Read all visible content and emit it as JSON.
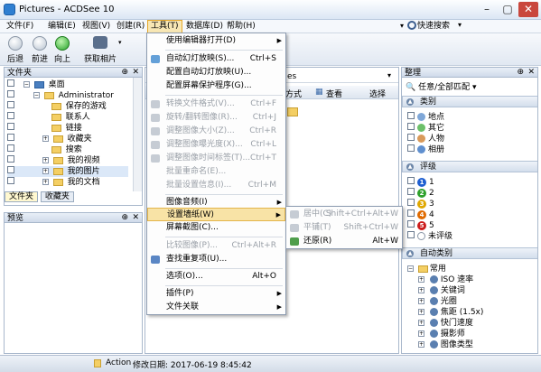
{
  "window": {
    "title": "Pictures - ACDSee 10"
  },
  "menubar": {
    "items": [
      "文件(F)",
      "编辑(E)",
      "视图(V)",
      "创建(R)",
      "工具(T)",
      "数据库(D)",
      "帮助(H)"
    ],
    "search_label": "快速搜索"
  },
  "toolbar": {
    "back": "后退",
    "forward": "前进",
    "up": "向上",
    "get_photos": "获取相片"
  },
  "folders_panel": {
    "title": "文件夹",
    "tree": [
      "桌面",
      "Administrator",
      "保存的游戏",
      "联系人",
      "链接",
      "收藏夹",
      "搜索",
      "我的视频",
      "我的图片",
      "我的文档"
    ],
    "tabs": [
      "文件夹",
      "收藏夹"
    ]
  },
  "preview_panel": {
    "title": "预览"
  },
  "browser": {
    "path_suffix": "es",
    "view_btn": "方式",
    "view2_btn": "查看",
    "select_btn": "选择"
  },
  "tools_menu": {
    "items": [
      {
        "label": "使用编辑器打开(D)",
        "shortcut": "",
        "submenu": true,
        "disabled": false
      },
      {
        "label": "自动幻灯放映(S)...",
        "shortcut": "Ctrl+S",
        "submenu": false,
        "disabled": false
      },
      {
        "label": "配置自动幻灯放映(U)...",
        "shortcut": "",
        "submenu": false,
        "disabled": false
      },
      {
        "label": "配置屏幕保护程序(G)...",
        "shortcut": "",
        "submenu": false,
        "disabled": false
      },
      {
        "label": "转换文件格式(V)...",
        "shortcut": "Ctrl+F",
        "submenu": false,
        "disabled": true
      },
      {
        "label": "旋转/翻转图像(R)...",
        "shortcut": "Ctrl+J",
        "submenu": false,
        "disabled": true
      },
      {
        "label": "调整图像大小(Z)...",
        "shortcut": "Ctrl+R",
        "submenu": false,
        "disabled": true
      },
      {
        "label": "调整图像曝光度(X)...",
        "shortcut": "Ctrl+L",
        "submenu": false,
        "disabled": true
      },
      {
        "label": "调整图像时间标签(T)...",
        "shortcut": "Ctrl+T",
        "submenu": false,
        "disabled": true
      },
      {
        "label": "批量重命名(E)...",
        "shortcut": "",
        "submenu": false,
        "disabled": true
      },
      {
        "label": "批量设置信息(I)...",
        "shortcut": "Ctrl+M",
        "submenu": false,
        "disabled": true
      },
      {
        "label": "图像音频(I)",
        "shortcut": "",
        "submenu": true,
        "disabled": false
      },
      {
        "label": "设置墙纸(W)",
        "shortcut": "",
        "submenu": true,
        "disabled": false
      },
      {
        "label": "屏幕截图(C)...",
        "shortcut": "",
        "submenu": false,
        "disabled": false
      },
      {
        "label": "比较图像(P)...",
        "shortcut": "Ctrl+Alt+R",
        "submenu": false,
        "disabled": true
      },
      {
        "label": "查找重复项(U)...",
        "shortcut": "",
        "submenu": false,
        "disabled": false
      },
      {
        "label": "选项(O)...",
        "shortcut": "Alt+O",
        "submenu": false,
        "disabled": false
      },
      {
        "label": "插件(P)",
        "shortcut": "",
        "submenu": true,
        "disabled": false
      },
      {
        "label": "文件关联",
        "shortcut": "",
        "submenu": true,
        "disabled": false
      }
    ]
  },
  "wallpaper_submenu": {
    "items": [
      {
        "label": "居中(C)",
        "shortcut": "Shift+Ctrl+Alt+W",
        "disabled": true
      },
      {
        "label": "平铺(T)",
        "shortcut": "Shift+Ctrl+W",
        "disabled": true
      },
      {
        "label": "还原(R)",
        "shortcut": "Alt+W",
        "disabled": false
      }
    ]
  },
  "organize_panel": {
    "title": "整理",
    "match_label": "任意/全部匹配",
    "sections": {
      "category": "类别",
      "rating": "评级",
      "auto": "自动类别"
    },
    "categories": [
      "地点",
      "其它",
      "人物",
      "相册"
    ],
    "ratings": [
      "1",
      "2",
      "3",
      "4",
      "5"
    ],
    "unrated": "未评级",
    "auto_items": [
      "常用",
      "ISO 速率",
      "关键词",
      "光圈",
      "焦距 (1.5x)",
      "快门速度",
      "摄影师",
      "图像类型"
    ]
  },
  "statusbar": {
    "action": "Action",
    "modified": "修改日期: 2017-06-19 8:45:42"
  },
  "colors": {
    "menu_highlight": "#f8e3a6",
    "titlebar": "#dbe6f4",
    "rating_colors": [
      "#1f5fd1",
      "#2ea12c",
      "#e0a800",
      "#e06a00",
      "#cc1d1d"
    ]
  }
}
